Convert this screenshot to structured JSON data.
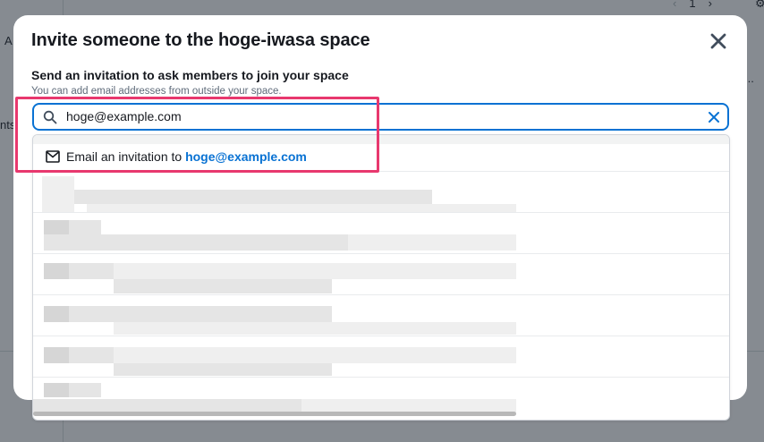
{
  "background": {
    "fragment_top_left": "A",
    "fragment_mid_left": "nts",
    "pager_page": "1",
    "more_dots": "..."
  },
  "modal": {
    "title": "Invite someone to the hoge-iwasa space",
    "close_icon": "close-icon",
    "field_label": "Send an invitation to ask members to join your space",
    "field_description": "You can add email addresses from outside your space.",
    "search": {
      "value": "hoge@example.com",
      "placeholder": "",
      "icon": "search-icon",
      "clear_icon": "clear-icon"
    },
    "dropdown": {
      "invite_option": {
        "icon": "mail-icon",
        "prefix": "Email an invitation to ",
        "email": "hoge@example.com"
      }
    }
  },
  "colors": {
    "accent": "#0972d3",
    "highlight": "#e8386e",
    "text": "#16191f"
  }
}
